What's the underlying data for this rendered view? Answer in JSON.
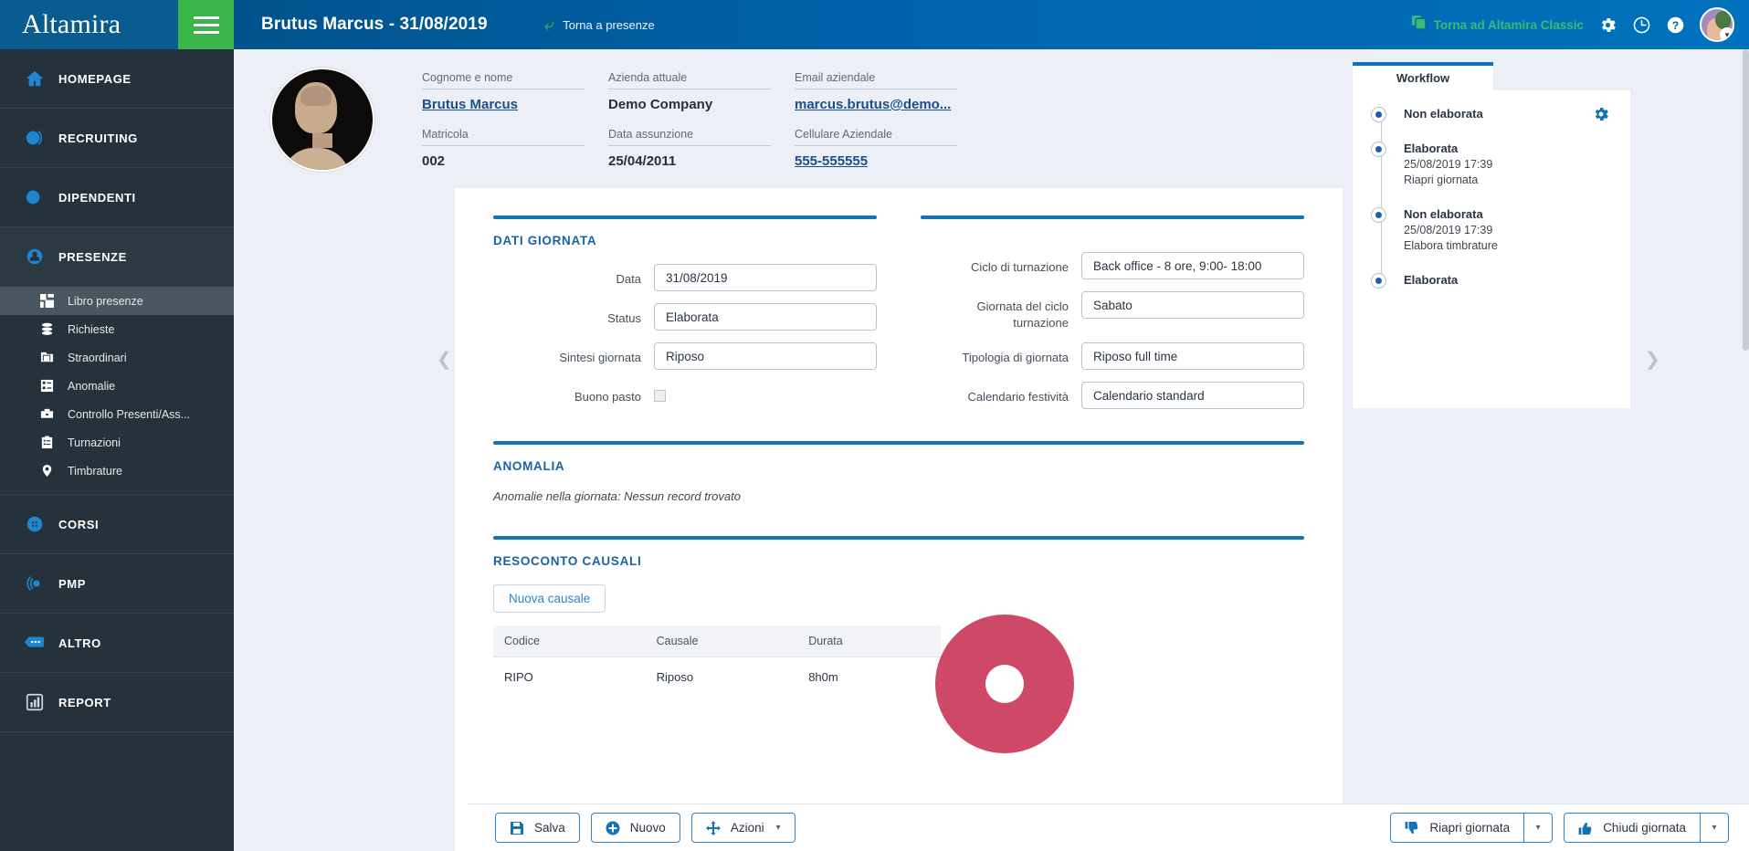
{
  "brand": {
    "name": "Altamira",
    "menu_icon": "hamburger-icon"
  },
  "sidebar": {
    "groups": [
      {
        "label": "HOMEPAGE",
        "icon": "home-icon",
        "active": false
      },
      {
        "label": "RECRUITING",
        "icon": "recruiting-icon",
        "active": false
      },
      {
        "label": "DIPENDENTI",
        "icon": "employees-icon",
        "active": false
      },
      {
        "label": "PRESENZE",
        "icon": "attendance-icon",
        "active": true
      },
      {
        "label": "CORSI",
        "icon": "courses-icon",
        "active": false
      },
      {
        "label": "PMP",
        "icon": "pmp-icon",
        "active": false
      },
      {
        "label": "ALTRO",
        "icon": "more-icon",
        "active": false
      },
      {
        "label": "REPORT",
        "icon": "report-icon",
        "active": false
      }
    ],
    "presenze_items": [
      {
        "label": "Libro presenze",
        "icon": "grid-icon",
        "selected": true
      },
      {
        "label": "Richieste",
        "icon": "database-icon",
        "selected": false
      },
      {
        "label": "Straordinari",
        "icon": "folder-icon",
        "selected": false
      },
      {
        "label": "Anomalie",
        "icon": "anomaly-icon",
        "selected": false
      },
      {
        "label": "Controllo Presenti/Ass...",
        "icon": "briefcase-icon",
        "selected": false
      },
      {
        "label": "Turnazioni",
        "icon": "clipboard-icon",
        "selected": false
      },
      {
        "label": "Timbrature",
        "icon": "pin-icon",
        "selected": false
      }
    ]
  },
  "topbar": {
    "title": "Brutus Marcus - 31/08/2019",
    "back_label": "Torna a presenze",
    "classic_label": "Torna ad Altamira Classic",
    "icons": [
      "gear-icon",
      "clock-icon",
      "help-icon"
    ]
  },
  "profile": {
    "photo_alt": "employee-photo",
    "fields": [
      {
        "label": "Cognome e nome",
        "value": "Brutus Marcus",
        "link": true
      },
      {
        "label": "Matricola",
        "value": "002",
        "link": false
      },
      {
        "label": "Azienda attuale",
        "value": "Demo Company",
        "link": false
      },
      {
        "label": "Data assunzione",
        "value": "25/04/2011",
        "link": false
      },
      {
        "label": "Email aziendale",
        "value": "marcus.brutus@demo...",
        "link": true
      },
      {
        "label": "Cellulare Aziendale",
        "value": "555-555555",
        "link": true
      }
    ]
  },
  "dati_giornata": {
    "title": "DATI GIORNATA",
    "left": [
      {
        "label": "Data",
        "value": "31/08/2019",
        "type": "text"
      },
      {
        "label": "Status",
        "value": "Elaborata",
        "type": "text"
      },
      {
        "label": "Sintesi giornata",
        "value": "Riposo",
        "type": "text"
      },
      {
        "label": "Buono pasto",
        "value": "",
        "type": "checkbox",
        "checked": false
      }
    ],
    "right": [
      {
        "label": "Ciclo di turnazione",
        "value": "Back office - 8 ore, 9:00- 18:00",
        "type": "text"
      },
      {
        "label": "Giornata del ciclo turnazione",
        "value": "Sabato",
        "type": "text"
      },
      {
        "label": "Tipologia di giornata",
        "value": "Riposo full time",
        "type": "text"
      },
      {
        "label": "Calendario festività",
        "value": "Calendario standard",
        "type": "text"
      }
    ]
  },
  "anomalia": {
    "title": "ANOMALIA",
    "message": "Anomalie nella giornata: Nessun record trovato"
  },
  "resoconto": {
    "title": "RESOCONTO CAUSALI",
    "new_button": "Nuova causale",
    "columns": [
      "Codice",
      "Causale",
      "Durata"
    ],
    "rows": [
      {
        "codice": "RIPO",
        "causale": "Riposo",
        "durata": "8h0m"
      }
    ]
  },
  "workflow": {
    "tab_label": "Workflow",
    "gear_icon": "gear-icon",
    "steps": [
      {
        "state": "Non elaborata",
        "timestamp": "",
        "action": ""
      },
      {
        "state": "Elaborata",
        "timestamp": "25/08/2019 17:39",
        "action": "Riapri giornata"
      },
      {
        "state": "Non elaborata",
        "timestamp": "25/08/2019 17:39",
        "action": "Elabora timbrature"
      },
      {
        "state": "Elaborata",
        "timestamp": "",
        "action": ""
      }
    ]
  },
  "bottombar": {
    "left": [
      {
        "label": "Salva",
        "icon": "save-icon",
        "split": false
      },
      {
        "label": "Nuovo",
        "icon": "plus-circle-icon",
        "split": false
      },
      {
        "label": "Azioni",
        "icon": "move-icon",
        "split": false,
        "caret": true
      }
    ],
    "right": [
      {
        "label": "Riapri giornata",
        "icon": "thumbs-down-icon",
        "split": true
      },
      {
        "label": "Chiudi giornata",
        "icon": "thumbs-up-icon",
        "split": true
      }
    ]
  },
  "colors": {
    "brand_blue": "#0a5c8f",
    "topbar_blue": "#0062a8",
    "green": "#39b54a",
    "sidebar": "#25323c",
    "accent": "#1273b8",
    "red_circle": "#ce4968"
  }
}
